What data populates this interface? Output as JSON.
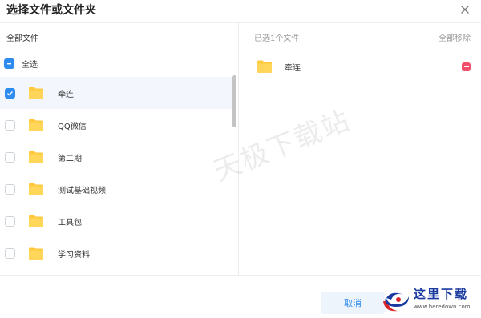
{
  "dialog": {
    "title": "选择文件或文件夹",
    "close_icon": "close-icon"
  },
  "left": {
    "header": "全部文件",
    "select_all_label": "全选",
    "select_all_state": "partial",
    "items": [
      {
        "name": "牵连",
        "checked": true
      },
      {
        "name": "QQ微信",
        "checked": false
      },
      {
        "name": "第二期",
        "checked": false
      },
      {
        "name": "测试基础视频",
        "checked": false
      },
      {
        "name": "工具包",
        "checked": false
      },
      {
        "name": "学习资料",
        "checked": false
      }
    ]
  },
  "right": {
    "header": "已选1个文件",
    "clear_all": "全部移除",
    "selected": [
      {
        "name": "牵连"
      }
    ]
  },
  "footer": {
    "cancel_label": "取消"
  },
  "watermark": "天极下载站",
  "site_logo": {
    "text": "这里下载",
    "url": "www.heredown.com"
  },
  "colors": {
    "accent": "#2e8cf0",
    "folder": "#ffc93d",
    "remove": "#f0506a"
  }
}
